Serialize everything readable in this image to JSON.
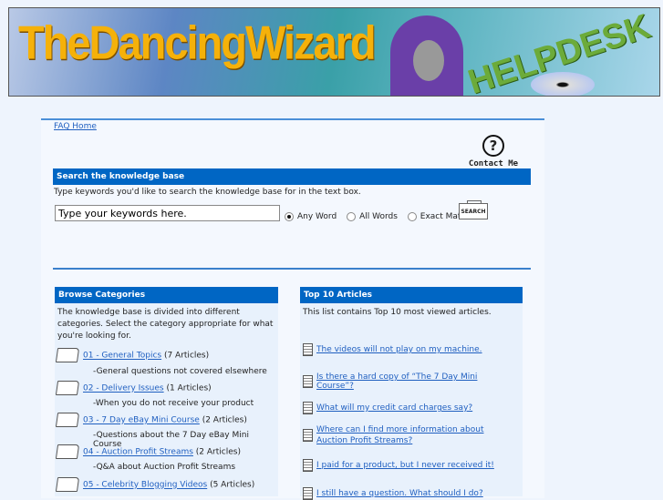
{
  "banner": {
    "logo_text": "TheDancingWizard",
    "subtitle": "HELPDESK"
  },
  "nav": {
    "faq_home": "FAQ Home",
    "contact": "Contact Me",
    "contact_icon": "?"
  },
  "search": {
    "title": "Search the knowledge base",
    "description": "Type keywords you'd like to search the knowledge base for in the text box.",
    "placeholder": "Type your keywords here.",
    "options": [
      "Any Word",
      "All Words",
      "Exact Match"
    ],
    "selected": "Any Word",
    "button": "SEARCH"
  },
  "browse": {
    "title": "Browse Categories",
    "description": "The knowledge base is divided into different categories. Select the category appropriate for what you're looking for.",
    "categories": [
      {
        "name": "01 - General Topics",
        "count": "(7 Articles)",
        "desc": "-General questions not covered elsewhere"
      },
      {
        "name": "02 - Delivery Issues",
        "count": "(1 Articles)",
        "desc": "-When you do not receive your product"
      },
      {
        "name": "03 - 7 Day eBay Mini Course",
        "count": "(2 Articles)",
        "desc": "-Questions about the 7 Day eBay Mini Course"
      },
      {
        "name": "04 - Auction Profit Streams",
        "count": "(2 Articles)",
        "desc": "-Q&A about Auction Profit Streams"
      },
      {
        "name": "05 - Celebrity Blogging Videos",
        "count": "(5 Articles)",
        "desc": ""
      }
    ]
  },
  "top10": {
    "title": "Top 10 Articles",
    "description": "This list contains Top 10 most viewed articles.",
    "articles": [
      "The videos will not play on my machine.",
      "Is there a hard copy of “The 7 Day Mini Course”?",
      "What will my credit card charges say?",
      "Where can I find more information about Auction Profit Streams?",
      "I paid for a product, but I never received it!",
      "I still have a question. What should I do?"
    ]
  }
}
